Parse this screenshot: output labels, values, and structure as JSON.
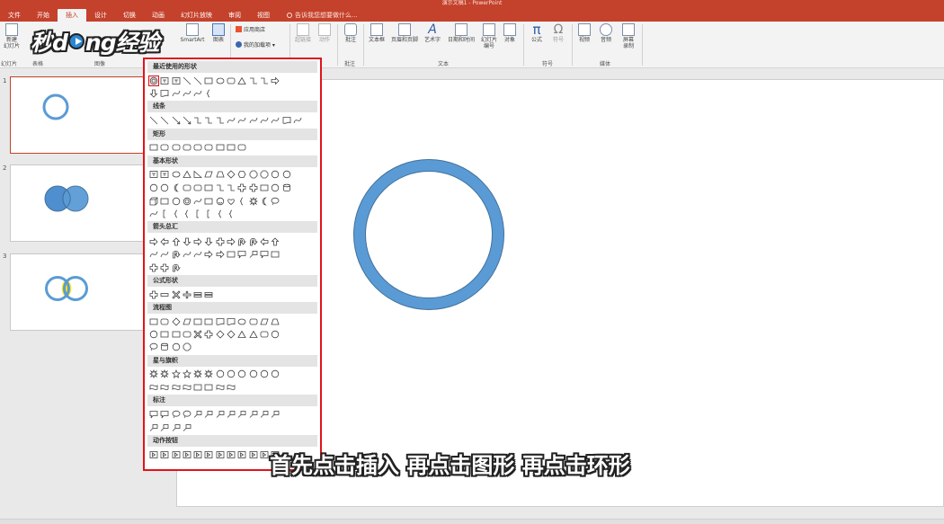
{
  "window": {
    "title": "演示文稿1 - PowerPoint"
  },
  "tabs": [
    {
      "label": "文件",
      "active": false
    },
    {
      "label": "开始",
      "active": false
    },
    {
      "label": "插入",
      "active": true
    },
    {
      "label": "设计",
      "active": false
    },
    {
      "label": "切换",
      "active": false
    },
    {
      "label": "动画",
      "active": false
    },
    {
      "label": "幻灯片放映",
      "active": false
    },
    {
      "label": "审阅",
      "active": false
    },
    {
      "label": "视图",
      "active": false
    }
  ],
  "tell_me": {
    "placeholder": "告诉我您想要做什么..."
  },
  "ribbon": {
    "new_slide": "新建\n幻灯片",
    "groups": {
      "slides": "幻灯片",
      "table": "表格",
      "images": "图像",
      "comments": "批注",
      "text": "文本",
      "symbols": "符号",
      "media": "媒体"
    },
    "smartart": "SmartArt",
    "chart": "图表",
    "store": "应用商店",
    "my_addins": "我的加载项",
    "hyperlink": "超链接",
    "action": "动作",
    "comment": "批注",
    "textbox": "文本框",
    "header_footer": "页眉和页脚",
    "wordart": "艺术字",
    "datetime": "日期和时间",
    "slide_number": "幻灯片\n编号",
    "object": "对象",
    "equation": "公式",
    "symbol": "符号",
    "video": "视频",
    "audio": "音频",
    "screen_record": "屏幕\n录制"
  },
  "thumbnails": [
    {
      "number": "1"
    },
    {
      "number": "2"
    },
    {
      "number": "3"
    }
  ],
  "shapes_panel": {
    "sections": [
      {
        "title": "最近使用的形状"
      },
      {
        "title": "线条"
      },
      {
        "title": "矩形"
      },
      {
        "title": "基本形状"
      },
      {
        "title": "箭头总汇"
      },
      {
        "title": "公式形状"
      },
      {
        "title": "流程图"
      },
      {
        "title": "星与旗帜"
      },
      {
        "title": "标注"
      },
      {
        "title": "动作按钮"
      }
    ]
  },
  "watermark": {
    "text_a": "秒",
    "text_b": "ng经验",
    "letter_d": "d"
  },
  "caption": "首先点击插入 再点击图形 再点击环形",
  "colors": {
    "accent": "#c4412b",
    "highlight": "#e0141b",
    "shape_fill": "#5b9bd5",
    "shape_stroke": "#41719c",
    "overlap": "#ffe600"
  }
}
